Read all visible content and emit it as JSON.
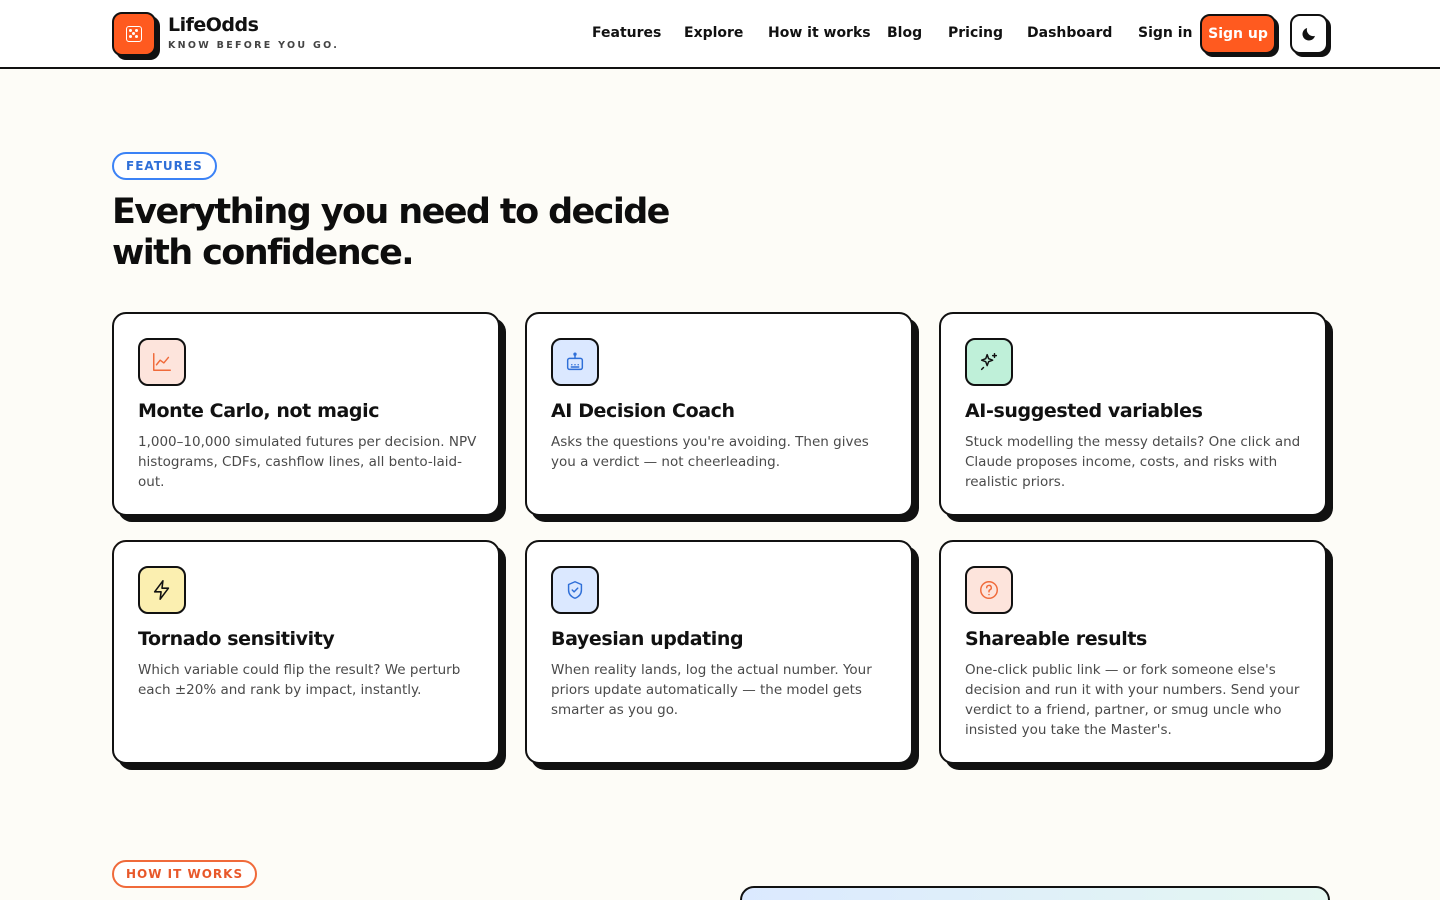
{
  "brand": {
    "name": "LifeOdds",
    "tagline": "KNOW BEFORE YOU GO.",
    "accent": "#ff5a1f"
  },
  "nav": {
    "links": [
      "Features",
      "Explore",
      "How it works",
      "Blog",
      "Pricing",
      "Dashboard"
    ],
    "sign_in": "Sign in",
    "sign_up": "Sign up",
    "theme_icon": "moon-icon"
  },
  "features": {
    "pill": "FEATURES",
    "title": "Everything you need to decide with confidence.",
    "cards": [
      {
        "icon": "line-chart-icon",
        "icon_bg": "#fde4dc",
        "title": "Monte Carlo, not magic",
        "desc": "1,000–10,000 simulated futures per decision. NPV histograms, CDFs, cashflow lines, all bento-laid-out."
      },
      {
        "icon": "robot-icon",
        "icon_bg": "#dbe8ff",
        "title": "AI Decision Coach",
        "desc": "Asks the questions you're avoiding. Then gives you a verdict — not cheerleading."
      },
      {
        "icon": "sparkles-icon",
        "icon_bg": "#bff0d9",
        "title": "AI-suggested variables",
        "desc": "Stuck modelling the messy details? One click and Claude proposes income, costs, and risks with realistic priors."
      },
      {
        "icon": "lightning-icon",
        "icon_bg": "#fbefb0",
        "title": "Tornado sensitivity",
        "desc": "Which variable could flip the result? We perturb each ±20% and rank by impact, instantly."
      },
      {
        "icon": "shield-check-icon",
        "icon_bg": "#dbe8ff",
        "title": "Bayesian updating",
        "desc": "When reality lands, log the actual number. Your priors update automatically — the model gets smarter as you go."
      },
      {
        "icon": "question-circle-icon",
        "icon_bg": "#fde4dc",
        "title": "Shareable results",
        "desc": "One-click public link — or fork someone else's decision and run it with your numbers. Send your verdict to a friend, partner, or smug uncle who insisted you take the Master's."
      }
    ]
  },
  "how_it_works": {
    "pill": "HOW IT WORKS"
  }
}
